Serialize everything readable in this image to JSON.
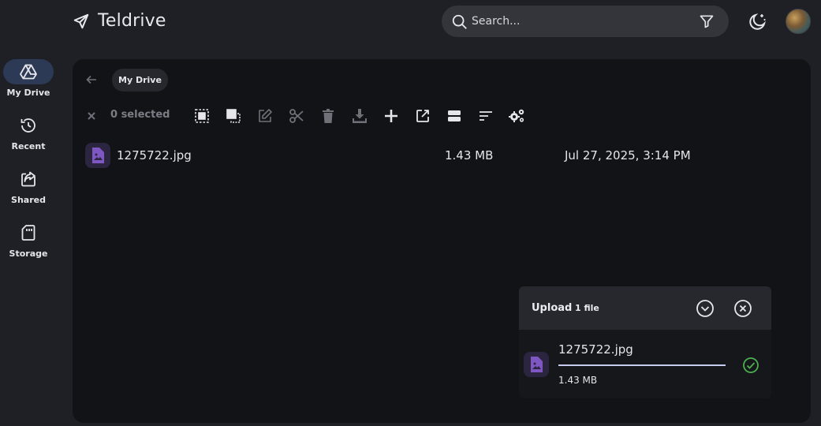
{
  "app": {
    "title": "Teldrive"
  },
  "search": {
    "placeholder": "Search..."
  },
  "sidebar": {
    "items": [
      {
        "label": "My Drive",
        "icon": "drive-icon",
        "active": true
      },
      {
        "label": "Recent",
        "icon": "history-icon",
        "active": false
      },
      {
        "label": "Shared",
        "icon": "share-icon",
        "active": false
      },
      {
        "label": "Storage",
        "icon": "sd-card-icon",
        "active": false
      }
    ]
  },
  "breadcrumb": {
    "current": "My Drive"
  },
  "toolbar": {
    "selected_label": "0 selected"
  },
  "files": [
    {
      "name": "1275722.jpg",
      "size": "1.43 MB",
      "modified": "Jul 27, 2025, 3:14 PM"
    }
  ],
  "upload": {
    "title": "Upload",
    "count": "1 file",
    "items": [
      {
        "name": "1275722.jpg",
        "size": "1.43 MB",
        "progress": 1.0,
        "status": "complete"
      }
    ]
  },
  "colors": {
    "accent": "#2c3a55",
    "file_icon": "#7e57c2",
    "success": "#4caf50",
    "progress": "#c8cbf0"
  }
}
